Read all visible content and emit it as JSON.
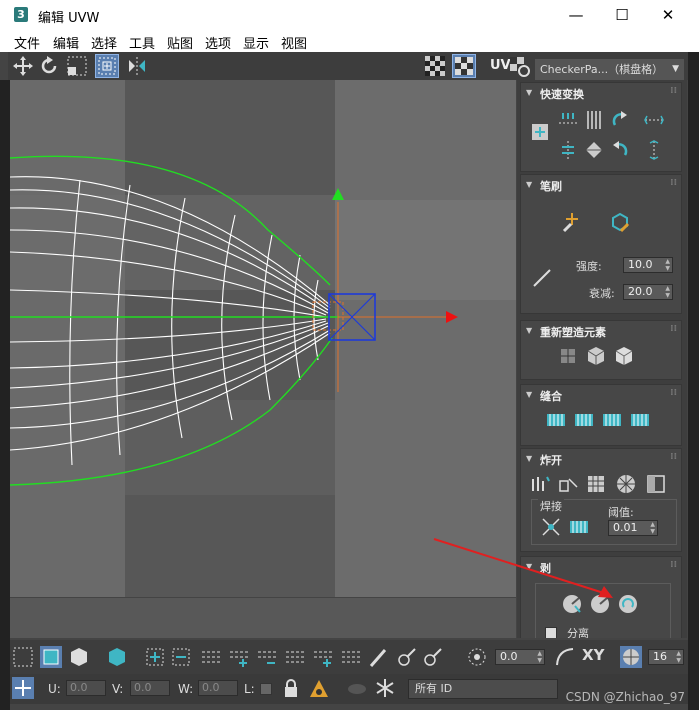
{
  "window": {
    "title": "编辑 UVW",
    "app_icon_label": "3",
    "minimize": "—",
    "maximize": "☐",
    "close": "✕"
  },
  "menu": [
    "文件",
    "编辑",
    "选择",
    "工具",
    "贴图",
    "选项",
    "显示",
    "视图"
  ],
  "toolbar": {
    "uv_label": "UV",
    "map_dropdown": "CheckerPa...（棋盘格）"
  },
  "panels": {
    "quick_transform": {
      "title": "快速变换"
    },
    "brush": {
      "title": "笔刷",
      "strength_label": "强度:",
      "strength_value": "10.0",
      "falloff_label": "衰减:",
      "falloff_value": "20.0"
    },
    "reshape": {
      "title": "重新塑造元素"
    },
    "stitch": {
      "title": "缝合"
    },
    "explode": {
      "title": "炸开",
      "weld_label": "焊接",
      "threshold_label": "阈值:",
      "threshold_value": "0.01"
    },
    "peel": {
      "title": "剥",
      "detach_label": "分离"
    }
  },
  "bottom": {
    "spinner_value": "0.0",
    "xy_label": "XY",
    "count_value": "16",
    "u_label": "U:",
    "u_value": "0.0",
    "v_label": "V:",
    "v_value": "0.0",
    "w_label": "W:",
    "w_value": "0.0",
    "l_label": "L:",
    "id_dropdown": "所有 ID"
  },
  "watermark": "CSDN @Zhichao_97",
  "colors": {
    "accent": "#3fb6c4",
    "selection": "#5a7fb0",
    "wire_white": "#ffffff",
    "wire_green": "#22dd22",
    "annotation_arrow": "#e02020"
  }
}
